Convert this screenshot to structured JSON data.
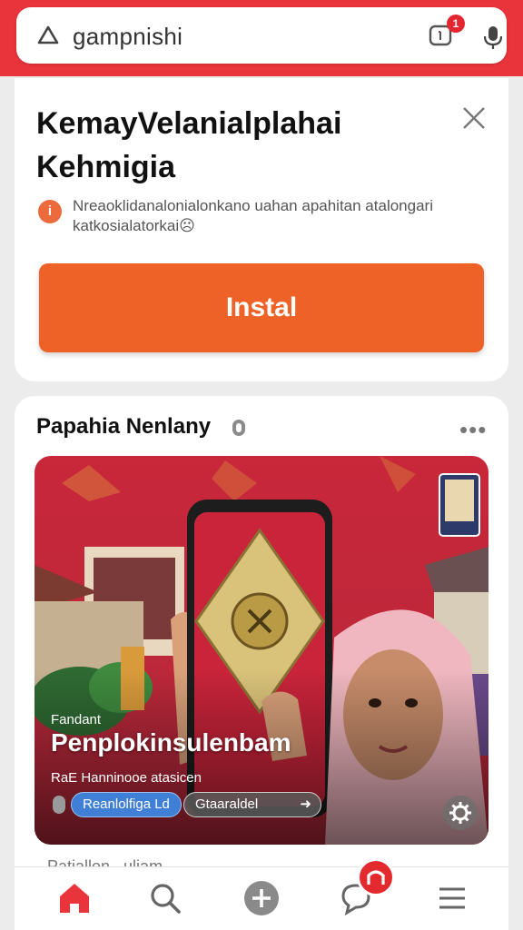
{
  "colors": {
    "brand_red": "#e8343a",
    "install_orange": "#ef6227",
    "chip_blue": "#3f7fd6"
  },
  "search": {
    "query": "gampnishi",
    "notification_count": "1",
    "left_icon": "triangle-icon",
    "right_icon": "mic-icon"
  },
  "promo": {
    "title": "KemayVelanialplahai Kehmigia",
    "description": "Nreaoklidanalonialonkano uahan apahitan atalongari katkosialatorkai☹",
    "install_label": "Instal",
    "info_icon": "info-icon",
    "close_icon": "close-icon"
  },
  "post": {
    "author": "Papahia Nenlany",
    "more_label": "•••",
    "media": {
      "kicker": "Fandant",
      "headline": "Penplokinsulenbam",
      "sub": "RaE Hanninooe atasicen",
      "chip_primary": "Reanlolfiga Ld",
      "chip_secondary": "Gtaaraldel",
      "chip_secondary_arrow": "➜"
    },
    "caption": "Patiallon ..uliam"
  },
  "nav": {
    "items": [
      "home-icon",
      "search-icon",
      "add-icon",
      "chat-icon",
      "menu-icon"
    ]
  }
}
